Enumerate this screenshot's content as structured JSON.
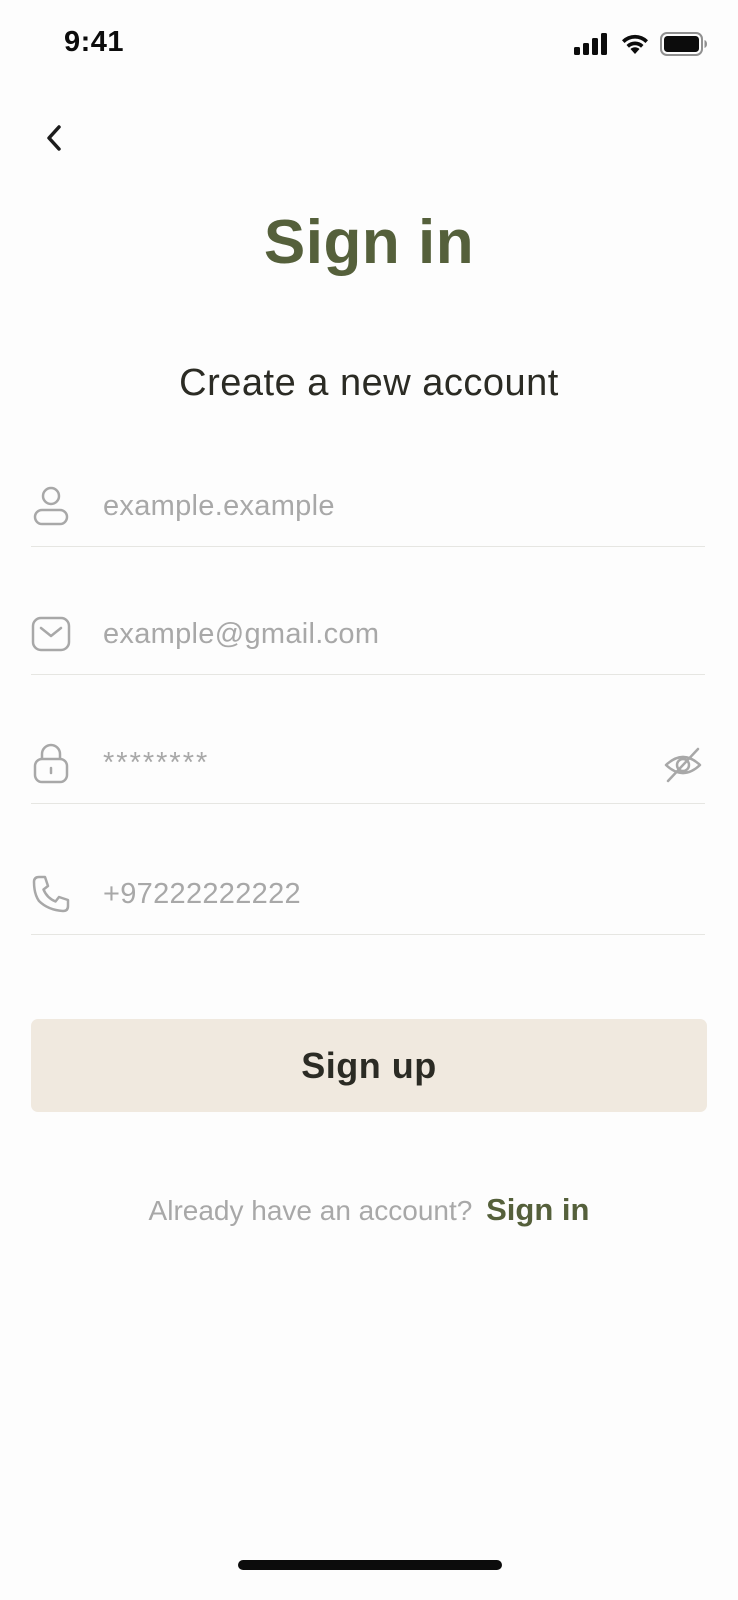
{
  "status_bar": {
    "time": "9:41",
    "signal_icon": "cellular-signal-icon",
    "wifi_icon": "wifi-icon",
    "battery_icon": "battery-icon"
  },
  "header": {
    "back_icon": "chevron-left-icon",
    "title": "Sign in",
    "subtitle": "Create a new account"
  },
  "form": {
    "username": {
      "icon": "user-icon",
      "value": "",
      "placeholder": "example.example"
    },
    "email": {
      "icon": "mail-icon",
      "value": "",
      "placeholder": "example@gmail.com"
    },
    "password": {
      "icon": "lock-icon",
      "value": "",
      "placeholder": "********",
      "toggle_icon": "eye-off-icon"
    },
    "phone": {
      "icon": "phone-icon",
      "value": "",
      "placeholder": "+97222222222"
    },
    "submit_label": "Sign up"
  },
  "footer": {
    "prompt": "Already have an account?",
    "link_label": "Sign in"
  },
  "colors": {
    "accent": "#55603b",
    "button_bg": "#f0e9df",
    "text": "#2b2b24",
    "placeholder": "#a8a8a8",
    "divider": "#e6e6e2",
    "background": "#fdfdfd"
  }
}
